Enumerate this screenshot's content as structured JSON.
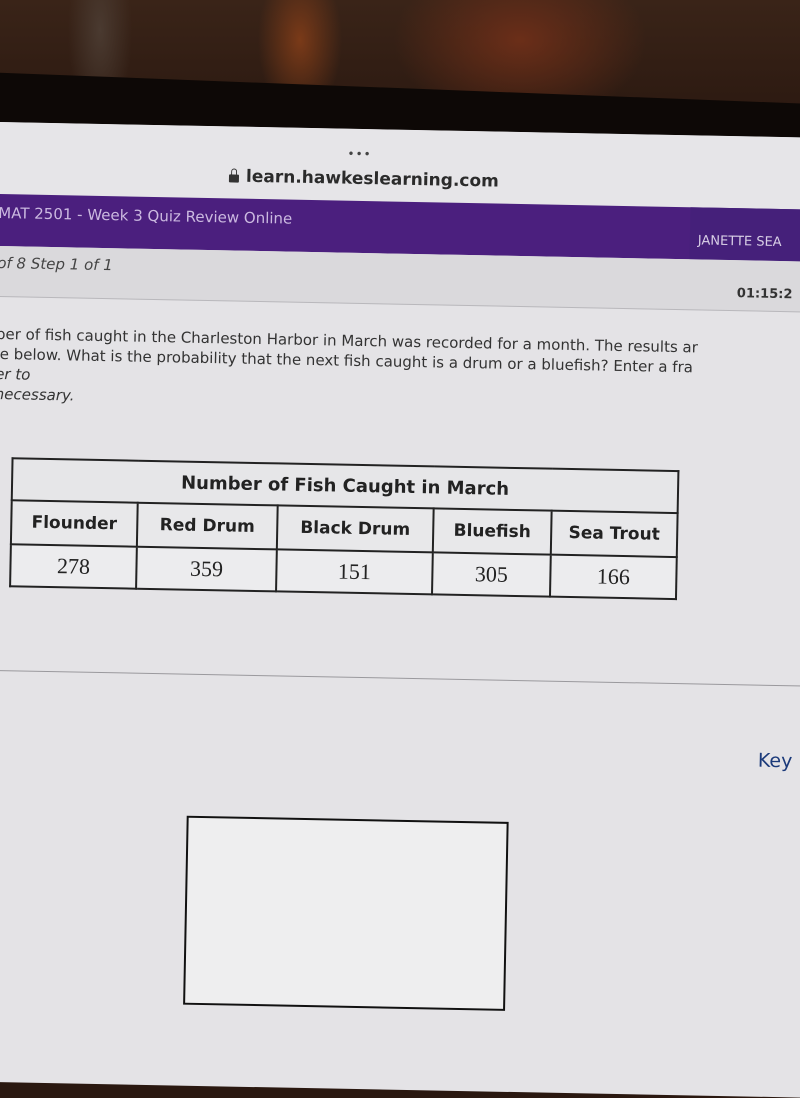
{
  "browser": {
    "menu_dots": "•••",
    "url": "learn.hawkeslearning.com"
  },
  "header": {
    "course_title": "MAT 2501 - Week 3 Quiz Review Online",
    "user_name": "JANETTE SEA",
    "brand_color": "#4b1f7e"
  },
  "progress": {
    "step_text": "of 8 Step 1 of 1",
    "timer": "01:15:2"
  },
  "question": {
    "lines": [
      "per of fish caught in the Charleston Harbor in March was recorded for a month. The results ar",
      "le below. What is the probability that the next fish caught is a drum or a bluefish? Enter a fra",
      "er to",
      "necessary."
    ]
  },
  "table": {
    "title": "Number of Fish Caught in March",
    "headers": [
      "Flounder",
      "Red Drum",
      "Black Drum",
      "Bluefish",
      "Sea Trout"
    ],
    "values": [
      "278",
      "359",
      "151",
      "305",
      "166"
    ]
  },
  "side_panel": {
    "key_label": "Key"
  },
  "answer": {
    "value": ""
  }
}
